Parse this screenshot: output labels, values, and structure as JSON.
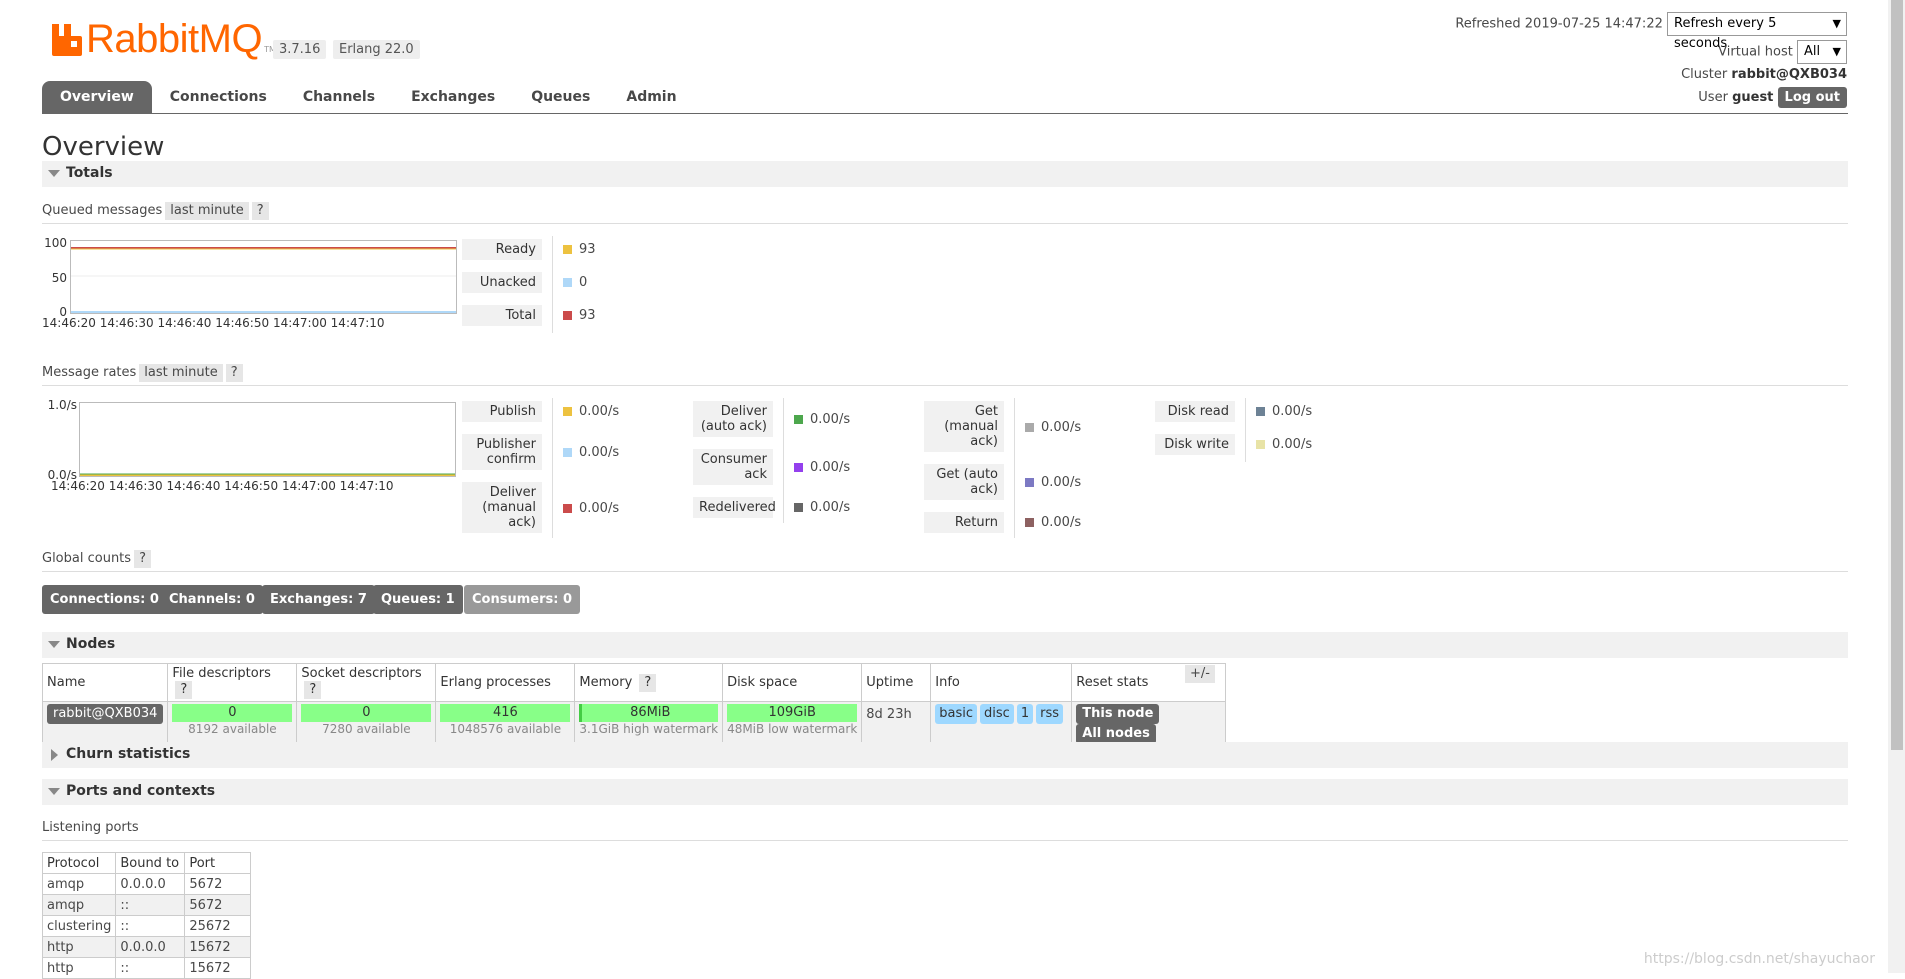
{
  "header": {
    "logo_text": "RabbitMQ",
    "logo_tm": "TM",
    "version": "3.7.16",
    "erlang": "Erlang 22.0",
    "refreshed_label": "Refreshed 2019-07-25 14:47:22",
    "refresh_select": "Refresh every 5 seconds",
    "vhost_label": "Virtual host",
    "vhost_value": "All",
    "cluster_label": "Cluster",
    "cluster_value": "rabbit@QXB034",
    "user_label": "User",
    "user_value": "guest",
    "logout": "Log out"
  },
  "nav": [
    "Overview",
    "Connections",
    "Channels",
    "Exchanges",
    "Queues",
    "Admin"
  ],
  "page_title": "Overview",
  "totals": {
    "section": "Totals",
    "queued_label": "Queued messages",
    "period": "last minute",
    "help": "?",
    "queued_chart": {
      "y_ticks": [
        "100",
        "50",
        "0"
      ],
      "x_ticks": [
        "14:46:20",
        "14:46:30",
        "14:46:40",
        "14:46:50",
        "14:47:00",
        "14:47:10"
      ]
    },
    "queued_stats": [
      {
        "label": "Ready",
        "value": "93",
        "color": "#edc240"
      },
      {
        "label": "Unacked",
        "value": "0",
        "color": "#afd8f8"
      },
      {
        "label": "Total",
        "value": "93",
        "color": "#cb4b4b"
      }
    ],
    "rates_label": "Message rates",
    "rates_chart": {
      "y_ticks": [
        "1.0/s",
        "0.0/s"
      ],
      "x_ticks": [
        "14:46:20",
        "14:46:30",
        "14:46:40",
        "14:46:50",
        "14:47:00",
        "14:47:10"
      ]
    },
    "rate_col1": [
      {
        "label": "Publish",
        "value": "0.00/s",
        "color": "#edc240"
      },
      {
        "label": "Publisher confirm",
        "value": "0.00/s",
        "color": "#afd8f8"
      },
      {
        "label": "Deliver (manual ack)",
        "value": "0.00/s",
        "color": "#cb4b4b"
      }
    ],
    "rate_col2": [
      {
        "label": "Deliver (auto ack)",
        "value": "0.00/s",
        "color": "#4da74d"
      },
      {
        "label": "Consumer ack",
        "value": "0.00/s",
        "color": "#9440ed"
      },
      {
        "label": "Redelivered",
        "value": "0.00/s",
        "color": "#666666"
      }
    ],
    "rate_col3": [
      {
        "label": "Get (manual ack)",
        "value": "0.00/s",
        "color": "#aaaaaa"
      },
      {
        "label": "Get (auto ack)",
        "value": "0.00/s",
        "color": "#7c79c3"
      },
      {
        "label": "Return",
        "value": "0.00/s",
        "color": "#8d6161"
      }
    ],
    "rate_col4": [
      {
        "label": "Disk read",
        "value": "0.00/s",
        "color": "#6d8295"
      },
      {
        "label": "Disk write",
        "value": "0.00/s",
        "color": "#e8e3a6"
      }
    ],
    "global_label": "Global counts",
    "counts": [
      "Connections: 0",
      "Channels: 0",
      "Exchanges: 7",
      "Queues: 1",
      "Consumers: 0"
    ]
  },
  "nodes": {
    "section": "Nodes",
    "headers": [
      "Name",
      "File descriptors",
      "Socket descriptors",
      "Erlang processes",
      "Memory",
      "Disk space",
      "Uptime",
      "Info",
      "Reset stats"
    ],
    "plusminus": "+/-",
    "row": {
      "name": "rabbit@QXB034",
      "fd": "0",
      "fd_avail": "8192 available",
      "sd": "0",
      "sd_avail": "7280 available",
      "ep": "416",
      "ep_avail": "1048576 available",
      "mem": "86MiB",
      "mem_sub": "3.1GiB high watermark",
      "disk": "109GiB",
      "disk_sub": "48MiB low watermark",
      "uptime": "8d 23h",
      "info": [
        "basic",
        "disc",
        "1",
        "rss"
      ],
      "reset_this": "This node",
      "reset_all": "All nodes"
    }
  },
  "churn": {
    "section": "Churn statistics"
  },
  "ports": {
    "section": "Ports and contexts",
    "listening_label": "Listening ports",
    "headers": [
      "Protocol",
      "Bound to",
      "Port"
    ],
    "rows": [
      [
        "amqp",
        "0.0.0.0",
        "5672"
      ],
      [
        "amqp",
        "::",
        "5672"
      ],
      [
        "clustering",
        "::",
        "25672"
      ],
      [
        "http",
        "0.0.0.0",
        "15672"
      ],
      [
        "http",
        "::",
        "15672"
      ]
    ]
  },
  "watermark": "https://blog.csdn.net/shayuchaor"
}
